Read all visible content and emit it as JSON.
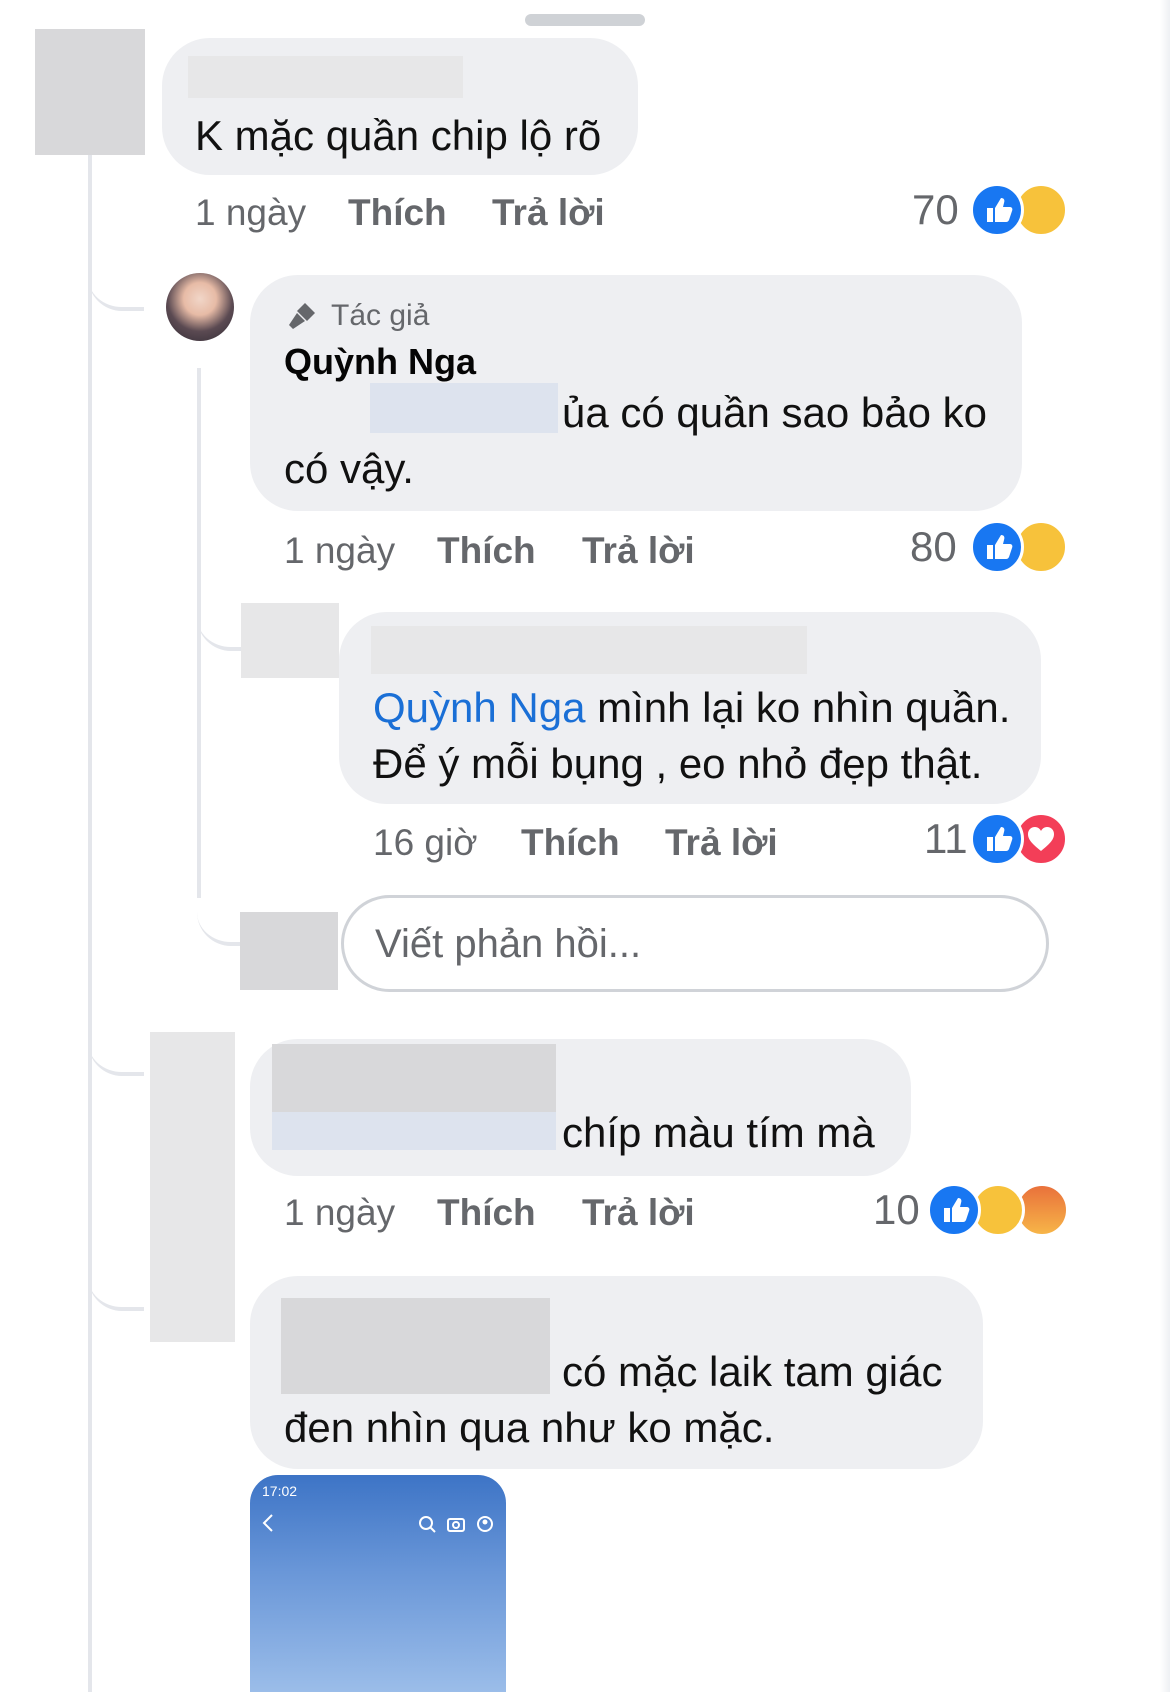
{
  "colors": {
    "like": "#1877f2",
    "mention": "#1a6fd6",
    "bubble": "#eeeff2",
    "meta": "#65676b"
  },
  "comment1": {
    "text": "K mặc quần chip lộ rõ",
    "time": "1 ngày",
    "like_label": "Thích",
    "reply_label": "Trả lời",
    "reaction_count": "70",
    "reactions": [
      "like-icon",
      "haha-icon"
    ]
  },
  "reply1": {
    "badge": "Tác giả",
    "author": "Quỳnh Nga",
    "text_line1": "ủa có quần sao bảo ko",
    "text_line2": "có vậy.",
    "time": "1 ngày",
    "like_label": "Thích",
    "reply_label": "Trả lời",
    "reaction_count": "80",
    "reactions": [
      "like-icon",
      "haha-icon"
    ]
  },
  "reply2": {
    "mention": "Quỳnh Nga",
    "text_line1": " mình lại ko nhìn quần.",
    "text_line2": "Để ý mỗi bụng , eo nhỏ đẹp thật.",
    "time": "16 giờ",
    "like_label": "Thích",
    "reply_label": "Trả lời",
    "reaction_count": "11",
    "reactions": [
      "like-icon",
      "love-icon"
    ]
  },
  "reply_input": {
    "placeholder": "Viết phản hồi..."
  },
  "comment2": {
    "text": "chíp màu tím mà",
    "time": "1 ngày",
    "like_label": "Thích",
    "reply_label": "Trả lời",
    "reaction_count": "10",
    "reactions": [
      "like-icon",
      "haha-icon",
      "angry-icon"
    ]
  },
  "comment3": {
    "text_line1": "có mặc laik tam giác",
    "text_line2": "đen nhìn qua như ko mặc."
  },
  "attachment": {
    "status_time": "17:02"
  }
}
